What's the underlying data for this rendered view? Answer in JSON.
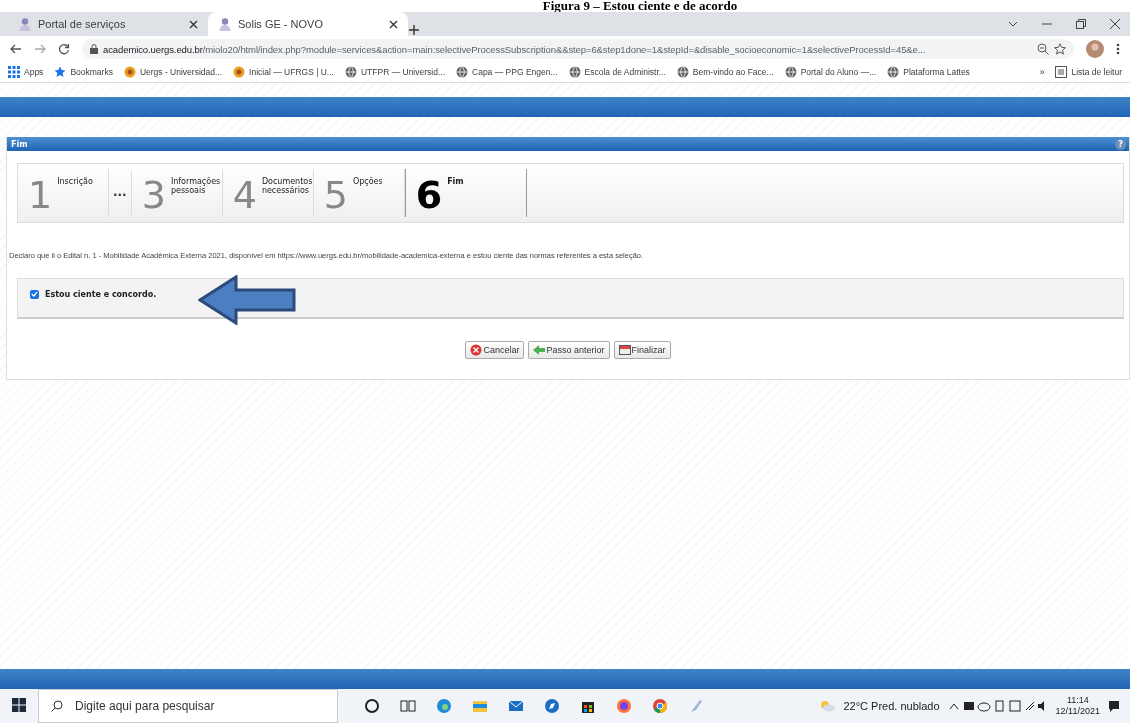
{
  "caption": "Figura 9 – Estou ciente e de acordo",
  "browser": {
    "tabs": [
      {
        "title": "Portal de serviços",
        "selected": false
      },
      {
        "title": "Solis GE - NOVO",
        "selected": true
      }
    ],
    "address": {
      "host": "academico.uergs.edu.br",
      "path": "/miolo20/html/index.php?module=services&action=main:selectiveProcessSubscription&&step=6&step1done=1&stepId=&disable_socioeconomic=1&selectiveProcessId=45&e..."
    },
    "bookmarks": [
      {
        "label": "Apps",
        "kind": "apps"
      },
      {
        "label": "Bookmarks",
        "kind": "star"
      },
      {
        "label": "Uergs - Universidad...",
        "kind": "site"
      },
      {
        "label": "Inicial — UFRGS | U...",
        "kind": "site"
      },
      {
        "label": "UTFPR — Universid...",
        "kind": "globe"
      },
      {
        "label": "Capa — PPG Engen...",
        "kind": "globe"
      },
      {
        "label": "Escola de Administr...",
        "kind": "globe"
      },
      {
        "label": "Bem-vindo ao Face...",
        "kind": "globe"
      },
      {
        "label": "Portal do Aluno —...",
        "kind": "globe"
      },
      {
        "label": "Plataforma Lattes",
        "kind": "globe"
      }
    ],
    "more": "»",
    "reading_list": "Lista de leitur"
  },
  "page": {
    "panel_title": "Fim",
    "help": "?",
    "steps": [
      {
        "kind": "step",
        "number": "1",
        "label": "Inscrição",
        "selected": false
      },
      {
        "kind": "ellipsis",
        "label": "..."
      },
      {
        "kind": "step",
        "number": "3",
        "label": "Informações pessoais",
        "selected": false
      },
      {
        "kind": "step",
        "number": "4",
        "label": "Documentos necessários",
        "selected": false
      },
      {
        "kind": "step",
        "number": "5",
        "label": "Opções",
        "selected": false
      },
      {
        "kind": "step",
        "number": "6",
        "label": "Fim",
        "selected": true
      }
    ],
    "declaration": "Declaro que li o Edital n. 1 - Mobilidade Acadêmica Externa 2021, disponível em https://www.uergs.edu.br/mobilidade-academica-externa e estou ciente das normas referentes a esta seleção.",
    "agree": {
      "label": "Estou ciente e concordo.",
      "checked": true
    },
    "buttons": [
      {
        "label": "Cancelar",
        "kind": "cancel"
      },
      {
        "label": "Passo anterior",
        "kind": "back"
      },
      {
        "label": "Finalizar",
        "kind": "finish"
      }
    ]
  },
  "taskbar": {
    "search_placeholder": "Digite aqui para pesquisar",
    "weather": "22°C  Pred. nublado",
    "time": "11:14",
    "date": "12/11/2021"
  }
}
